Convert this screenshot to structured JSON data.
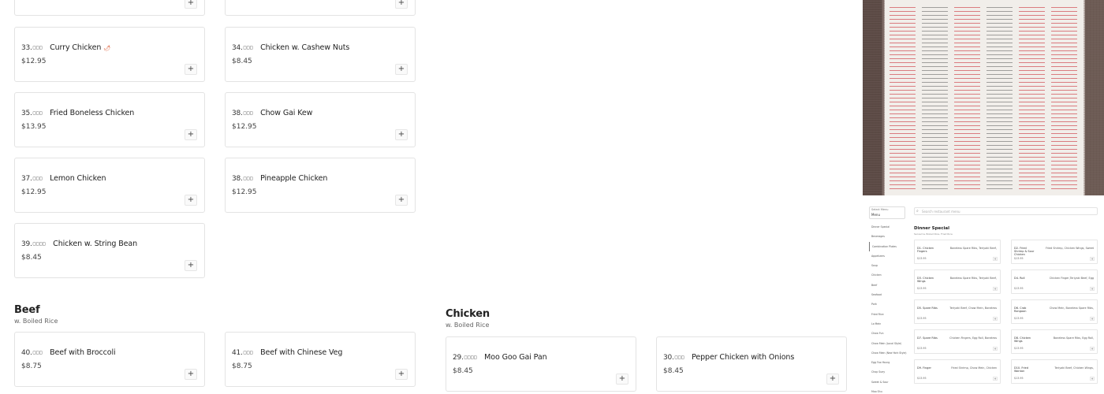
{
  "cards": {
    "c_top_left": {
      "add": "+"
    },
    "c_top_right": {
      "add": "+"
    },
    "c33": {
      "num": "33.",
      "cn": "□□□",
      "name": "Curry Chicken",
      "spicy": "🌶",
      "price": "$12.95",
      "add": "+"
    },
    "c34": {
      "num": "34.",
      "cn": "□□□",
      "name": "Chicken w. Cashew Nuts",
      "price": "$8.45",
      "add": "+"
    },
    "c35": {
      "num": "35.",
      "cn": "□□□",
      "name": "Fried Boneless Chicken",
      "price": "$13.95",
      "add": "+"
    },
    "c38a": {
      "num": "38.",
      "cn": "□□□",
      "name": "Chow Gai Kew",
      "price": "$12.95",
      "add": "+"
    },
    "c37": {
      "num": "37.",
      "cn": "□□□",
      "name": "Lemon Chicken",
      "price": "$12.95",
      "add": "+"
    },
    "c38b": {
      "num": "38.",
      "cn": "□□□",
      "name": "Pineapple Chicken",
      "price": "$12.95",
      "add": "+"
    },
    "c39": {
      "num": "39.",
      "cn": "□□□□",
      "name": "Chicken w. String Bean",
      "price": "$8.45",
      "add": "+"
    },
    "c40": {
      "num": "40.",
      "cn": "□□□",
      "name": "Beef with Broccoli",
      "price": "$8.75",
      "add": "+"
    },
    "c41": {
      "num": "41.",
      "cn": "□□□",
      "name": "Beef with Chinese Veg",
      "price": "$8.75",
      "add": "+"
    },
    "c29": {
      "num": "29.",
      "cn": "□□□□",
      "name": "Moo Goo Gai Pan",
      "price": "$8.45",
      "add": "+"
    },
    "c30": {
      "num": "30.",
      "cn": "□□□",
      "name": "Pepper Chicken with Onions",
      "price": "$8.45",
      "add": "+"
    }
  },
  "sections": {
    "beef": {
      "title": "Beef",
      "subtitle": "w. Boiled Rice"
    },
    "chicken": {
      "title": "Chicken",
      "subtitle": "w. Boiled Rice"
    }
  },
  "thumbnail": {
    "select_label": "Select Menu",
    "select_value": "Menu",
    "search_placeholder": "Search restaurant menu",
    "search_icon": "search-icon",
    "nav": [
      "Dinner Special",
      "Beverages",
      "Combination Plates",
      "Appetizers",
      "Soup",
      "Chicken",
      "Beef",
      "Seafood",
      "Pork",
      "Fried Rice",
      "Lo Mein",
      "Chow Fun",
      "Chow Mein (Local Style)",
      "Chow Mein (New York Style)",
      "Egg Foo Young",
      "Chop Suey",
      "Sweet & Sour",
      "Moo Shu"
    ],
    "section_title": "Dinner Special",
    "section_subtitle": "Served w. Boiled Rice, Fried Rice",
    "items": [
      {
        "title": "D1. Chicken Fingers",
        "desc": "Boneless Spare Ribs, Teriyaki Beef,",
        "price": "$13.95"
      },
      {
        "title": "D2. Fried Shrimp & Sour Chicken",
        "desc": "Fried Shrimp, Chicken Wings, Sweet",
        "price": "$13.95"
      },
      {
        "title": "D3. Chicken Wings",
        "desc": "Boneless Spare Ribs, Teriyaki Beef,",
        "price": "$13.95"
      },
      {
        "title": "D4. Roll",
        "desc": "Chicken Finger,Teriyaki Beef, Egg",
        "price": "$13.95"
      },
      {
        "title": "D5. Spare Ribs",
        "desc": "Teriyaki Beef, Chow Mein, Boneless",
        "price": "$13.95"
      },
      {
        "title": "D6. Crab Rangoon",
        "desc": "Chow Mein, Boneless Spare Ribs,",
        "price": "$13.95"
      },
      {
        "title": "D7. Spare Ribs",
        "desc": "Chicken Fingers, Egg Roll, Boneless",
        "price": "$13.95"
      },
      {
        "title": "D8. Chicken Wings",
        "desc": "Boneless Spare Ribs, Egg Roll,",
        "price": "$13.95"
      },
      {
        "title": "D9. Finger",
        "desc": "Fried Shrimp, Chow Mein, Chicken",
        "price": "$13.95"
      },
      {
        "title": "D10. Fried Wonton",
        "desc": "Teriyaki Beef, Chicken Wings,",
        "price": "$13.95"
      }
    ],
    "add": "+"
  },
  "colors": {
    "accent_chili": "#d9532b",
    "card_border": "#e3e3e3",
    "photo_ink": "#c81e28"
  }
}
